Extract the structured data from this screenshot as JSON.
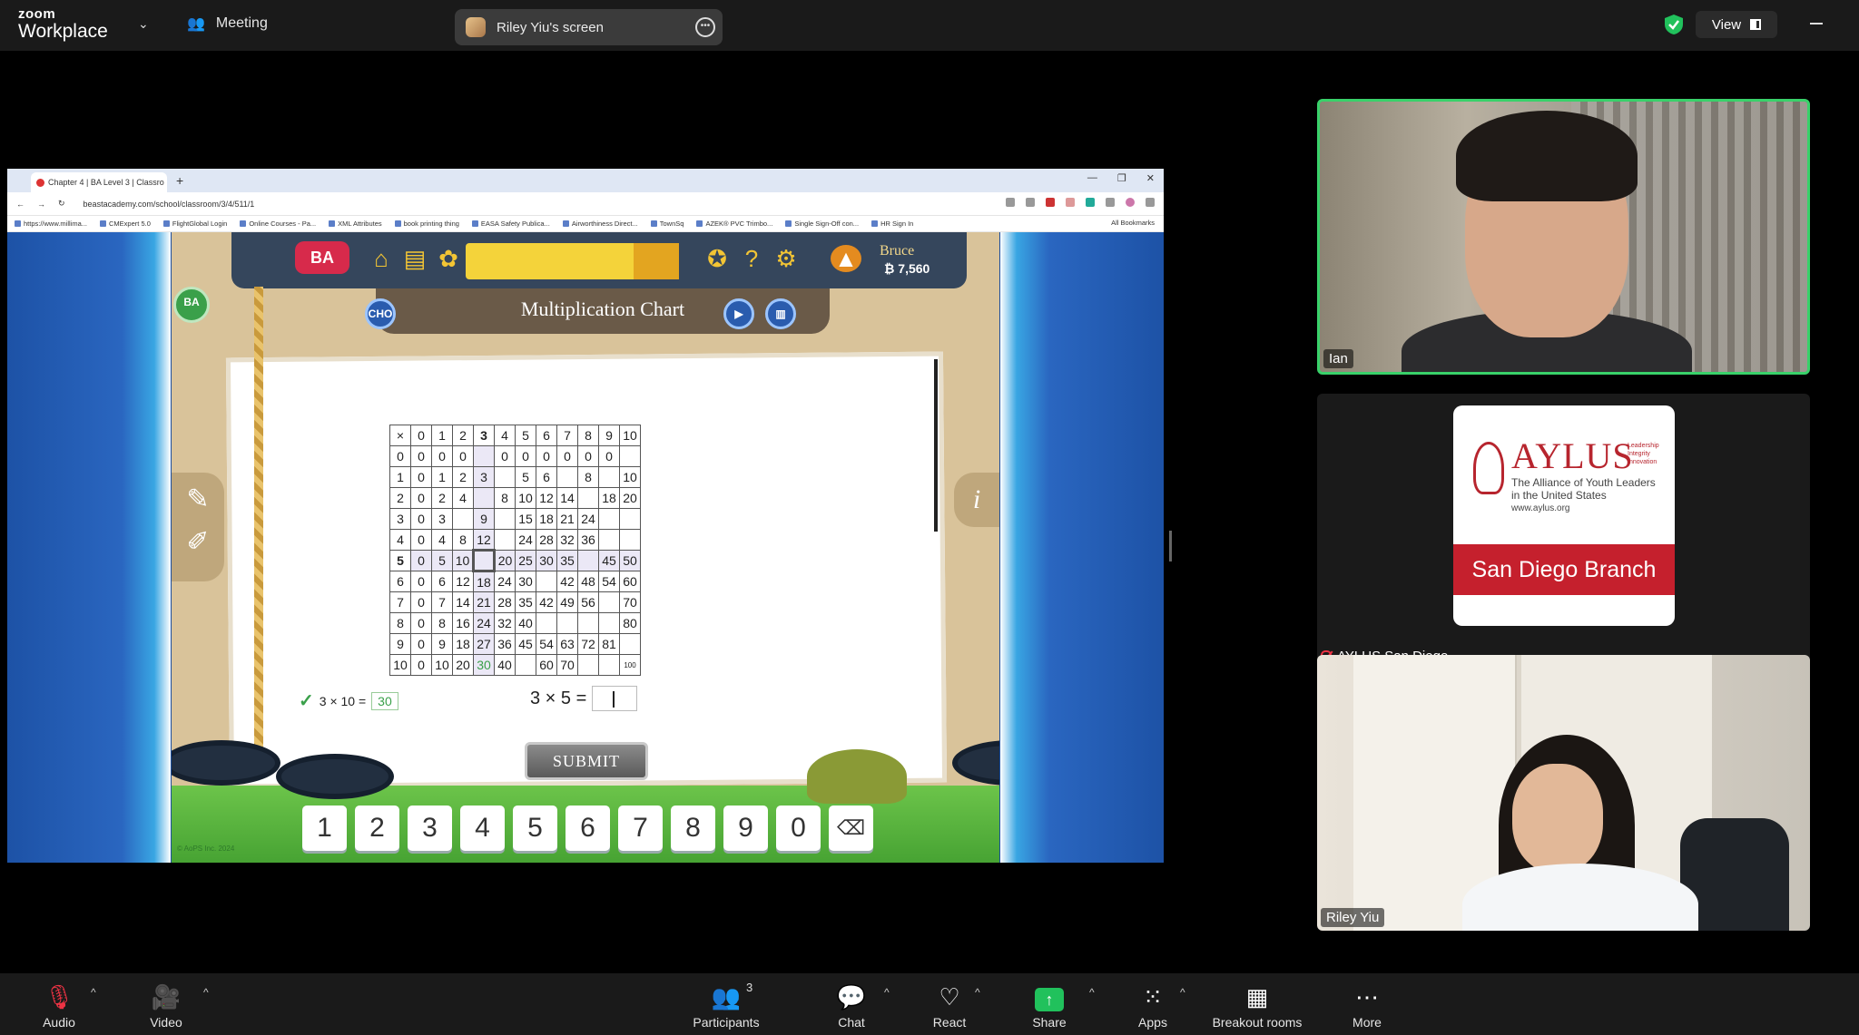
{
  "zoom": {
    "logo_line1": "zoom",
    "logo_line2": "Workplace",
    "meeting_menu": "Meeting",
    "share_banner": "Riley Yiu's screen",
    "view_label": "View"
  },
  "browser": {
    "tab_title": "Chapter 4 | BA Level 3 | Classro",
    "url": "beastacademy.com/school/classroom/3/4/511/1",
    "bookmarks": [
      "https://www.millima...",
      "CMExpert 5.0",
      "FlightGlobal Login",
      "Online Courses - Pa...",
      "XML Attributes",
      "book printing thing",
      "EASA Safety Publica...",
      "Airworthiness Direct...",
      "TownSq",
      "AZEK® PVC Trimbo...",
      "Single Sign-Off con...",
      "HR Sign In"
    ],
    "all_bookmarks": "All Bookmarks"
  },
  "game": {
    "logo": "BA",
    "user_name": "Bruce",
    "user_coins": "₿ 7,560",
    "title": "Multiplication Chart",
    "left_badge": "BA",
    "header_badge": "CHO",
    "chart": {
      "header": [
        "×",
        "0",
        "1",
        "2",
        "3",
        "4",
        "5",
        "6",
        "7",
        "8",
        "9",
        "10"
      ],
      "rows": [
        [
          "0",
          "0",
          "0",
          "0",
          "",
          "0",
          "0",
          "0",
          "0",
          "0",
          "0",
          ""
        ],
        [
          "1",
          "0",
          "1",
          "2",
          "3",
          "",
          "5",
          "6",
          "",
          "8",
          "",
          "10"
        ],
        [
          "2",
          "0",
          "2",
          "4",
          "",
          "8",
          "10",
          "12",
          "14",
          "",
          "18",
          "20"
        ],
        [
          "3",
          "0",
          "3",
          "",
          "9",
          "",
          "15",
          "18",
          "21",
          "24",
          "",
          ""
        ],
        [
          "4",
          "0",
          "4",
          "8",
          "12",
          "",
          "24",
          "28",
          "32",
          "36",
          "",
          ""
        ],
        [
          "5",
          "0",
          "5",
          "10",
          "",
          "20",
          "25",
          "30",
          "35",
          "",
          "45",
          "50"
        ],
        [
          "6",
          "0",
          "6",
          "12",
          "18",
          "24",
          "30",
          "",
          "42",
          "48",
          "54",
          "60"
        ],
        [
          "7",
          "0",
          "7",
          "14",
          "21",
          "28",
          "35",
          "42",
          "49",
          "56",
          "",
          "70"
        ],
        [
          "8",
          "0",
          "8",
          "16",
          "24",
          "32",
          "40",
          "",
          "",
          "",
          "",
          "80"
        ],
        [
          "9",
          "0",
          "9",
          "18",
          "27",
          "36",
          "45",
          "54",
          "63",
          "72",
          "81",
          ""
        ],
        [
          "10",
          "0",
          "10",
          "20",
          "30",
          "40",
          "",
          "60",
          "70",
          "",
          "",
          "100"
        ]
      ]
    },
    "previous": {
      "expr": "3 × 10 =",
      "answer": "30"
    },
    "question": "3 × 5 =",
    "submit": "SUBMIT",
    "keypad": [
      "1",
      "2",
      "3",
      "4",
      "5",
      "6",
      "7",
      "8",
      "9",
      "0"
    ],
    "copyright": "© AoPS Inc. 2024"
  },
  "participants_tiles": [
    {
      "name": "Ian"
    },
    {
      "name": "AYLUS San Diego"
    },
    {
      "name": "Riley Yiu"
    }
  ],
  "aylus_card": {
    "name": "AYLUS",
    "tagline": "Leadership Integrity Innovation",
    "desc": "The Alliance of Youth Leaders in the United States",
    "url": "www.aylus.org",
    "branch": "San Diego Branch"
  },
  "toolbar": {
    "audio": "Audio",
    "video": "Video",
    "participants": "Participants",
    "participants_count": "3",
    "chat": "Chat",
    "react": "React",
    "share": "Share",
    "apps": "Apps",
    "breakout": "Breakout rooms",
    "more": "More"
  },
  "colors": {
    "speaker_border": "#39d16a",
    "share_green": "#21c15c",
    "brand_red": "#c5202d"
  }
}
